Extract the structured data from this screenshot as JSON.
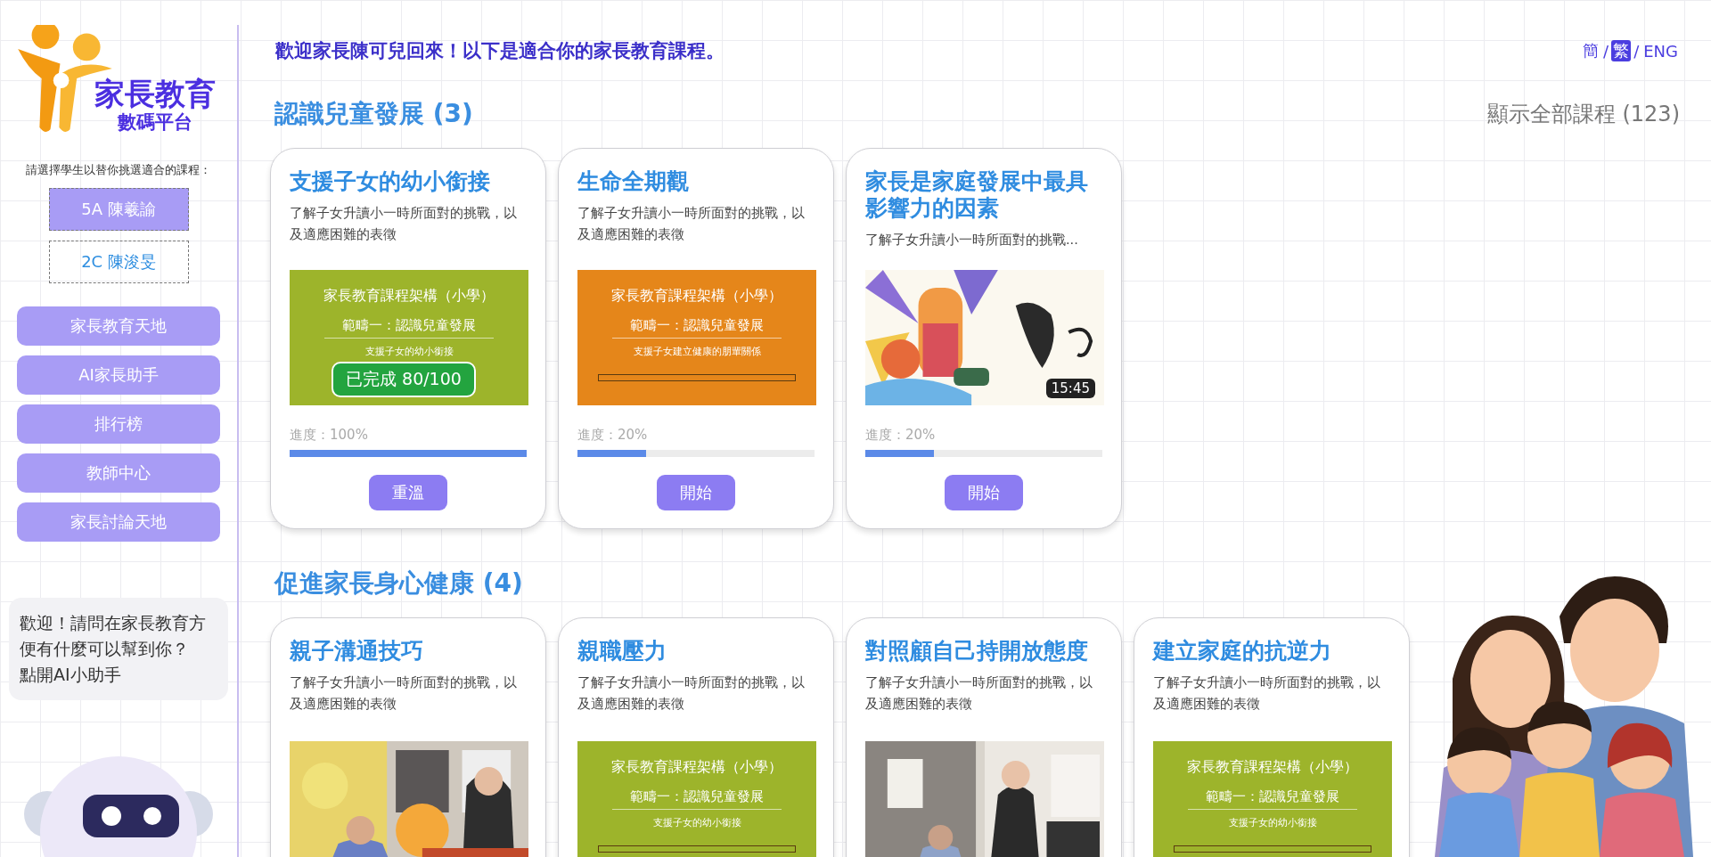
{
  "sidebar": {
    "logo": {
      "title": "家長教育",
      "subtitle": "數碼平台"
    },
    "student_prompt": "請選擇學生以替你挑選適合的課程：",
    "students": [
      {
        "label": "5A 陳羲諭",
        "selected": true
      },
      {
        "label": "2C 陳浚旻",
        "selected": false
      }
    ],
    "nav_items": [
      "家長教育天地",
      "AI家長助手",
      "排行榜",
      "教師中心",
      "家長討論天地"
    ],
    "assistant_message": [
      "歡迎！請問在家長教育方便有什麼可以幫到你？",
      "點開AI小助手"
    ]
  },
  "header": {
    "welcome": "歡迎家長陳可兒回來！以下是適合你的家長教育課程。",
    "languages": [
      {
        "label": "簡",
        "selected": false
      },
      {
        "label": "繁",
        "selected": true
      },
      {
        "label": "ENG",
        "selected": false
      }
    ],
    "separators": [
      "/",
      "/"
    ]
  },
  "sections": [
    {
      "title": "認識兒童發展 (3)",
      "show_all": "顯示全部課程 (123)",
      "courses": [
        {
          "title": "支援子女的幼小銜接",
          "description": "了解子女升讀小一時所面對的挑戰，以及適應困難的表徵",
          "thumbnail": {
            "kind": "slide",
            "color": "#9db42b",
            "lines": [
              "家長教育課程架構（小學）",
              "範疇一：認識兒童發展",
              "支援子女的幼小銜接"
            ],
            "footnote_bar": false
          },
          "badge": "已完成 80/100",
          "progress": {
            "label": "進度：100%",
            "level": 1.0
          },
          "action": "重溫"
        },
        {
          "title": "生命全期觀",
          "description": "了解子女升讀小一時所面對的挑戰，以及適應困難的表徵",
          "thumbnail": {
            "kind": "slide",
            "color": "#e5861a",
            "lines": [
              "家長教育課程架構（小學）",
              "範疇一：認識兒童發展",
              "支援子女建立健康的朋輩關係"
            ],
            "footnote_bar": true
          },
          "progress": {
            "label": "進度：20%",
            "level": 0.29
          },
          "action": "開始"
        },
        {
          "title": "家長是家庭發展中最具影響力的因素",
          "description": "了解子女升讀小一時所面對的挑戰...",
          "duration": "15:45",
          "progress": {
            "label": "進度：20%",
            "level": 0.29
          },
          "action": "開始"
        }
      ]
    },
    {
      "title": "促進家長身心健康 (4)",
      "courses": [
        {
          "title": "親子溝通技巧",
          "description": "了解子女升讀小一時所面對的挑戰，以及適應困難的表徵"
        },
        {
          "title": "親職壓力",
          "description": "了解子女升讀小一時所面對的挑戰，以及適應困難的表徵",
          "thumbnail": {
            "kind": "slide",
            "color": "#9db42b",
            "lines": [
              "家長教育課程架構（小學）",
              "範疇一：認識兒童發展",
              "支援子女的幼小銜接"
            ],
            "footnote_bar": true
          }
        },
        {
          "title": "對照顧自己持開放態度",
          "description": "了解子女升讀小一時所面對的挑戰，以及適應困難的表徵"
        },
        {
          "title": "建立家庭的抗逆力",
          "description": "了解子女升讀小一時所面對的挑戰，以及適應困難的表徵",
          "thumbnail": {
            "kind": "slide",
            "color": "#9db42b",
            "lines": [
              "家長教育課程架構（小學）",
              "範疇一：認識兒童發展",
              "支援子女的幼小銜接"
            ],
            "footnote_bar": true
          }
        }
      ]
    }
  ]
}
